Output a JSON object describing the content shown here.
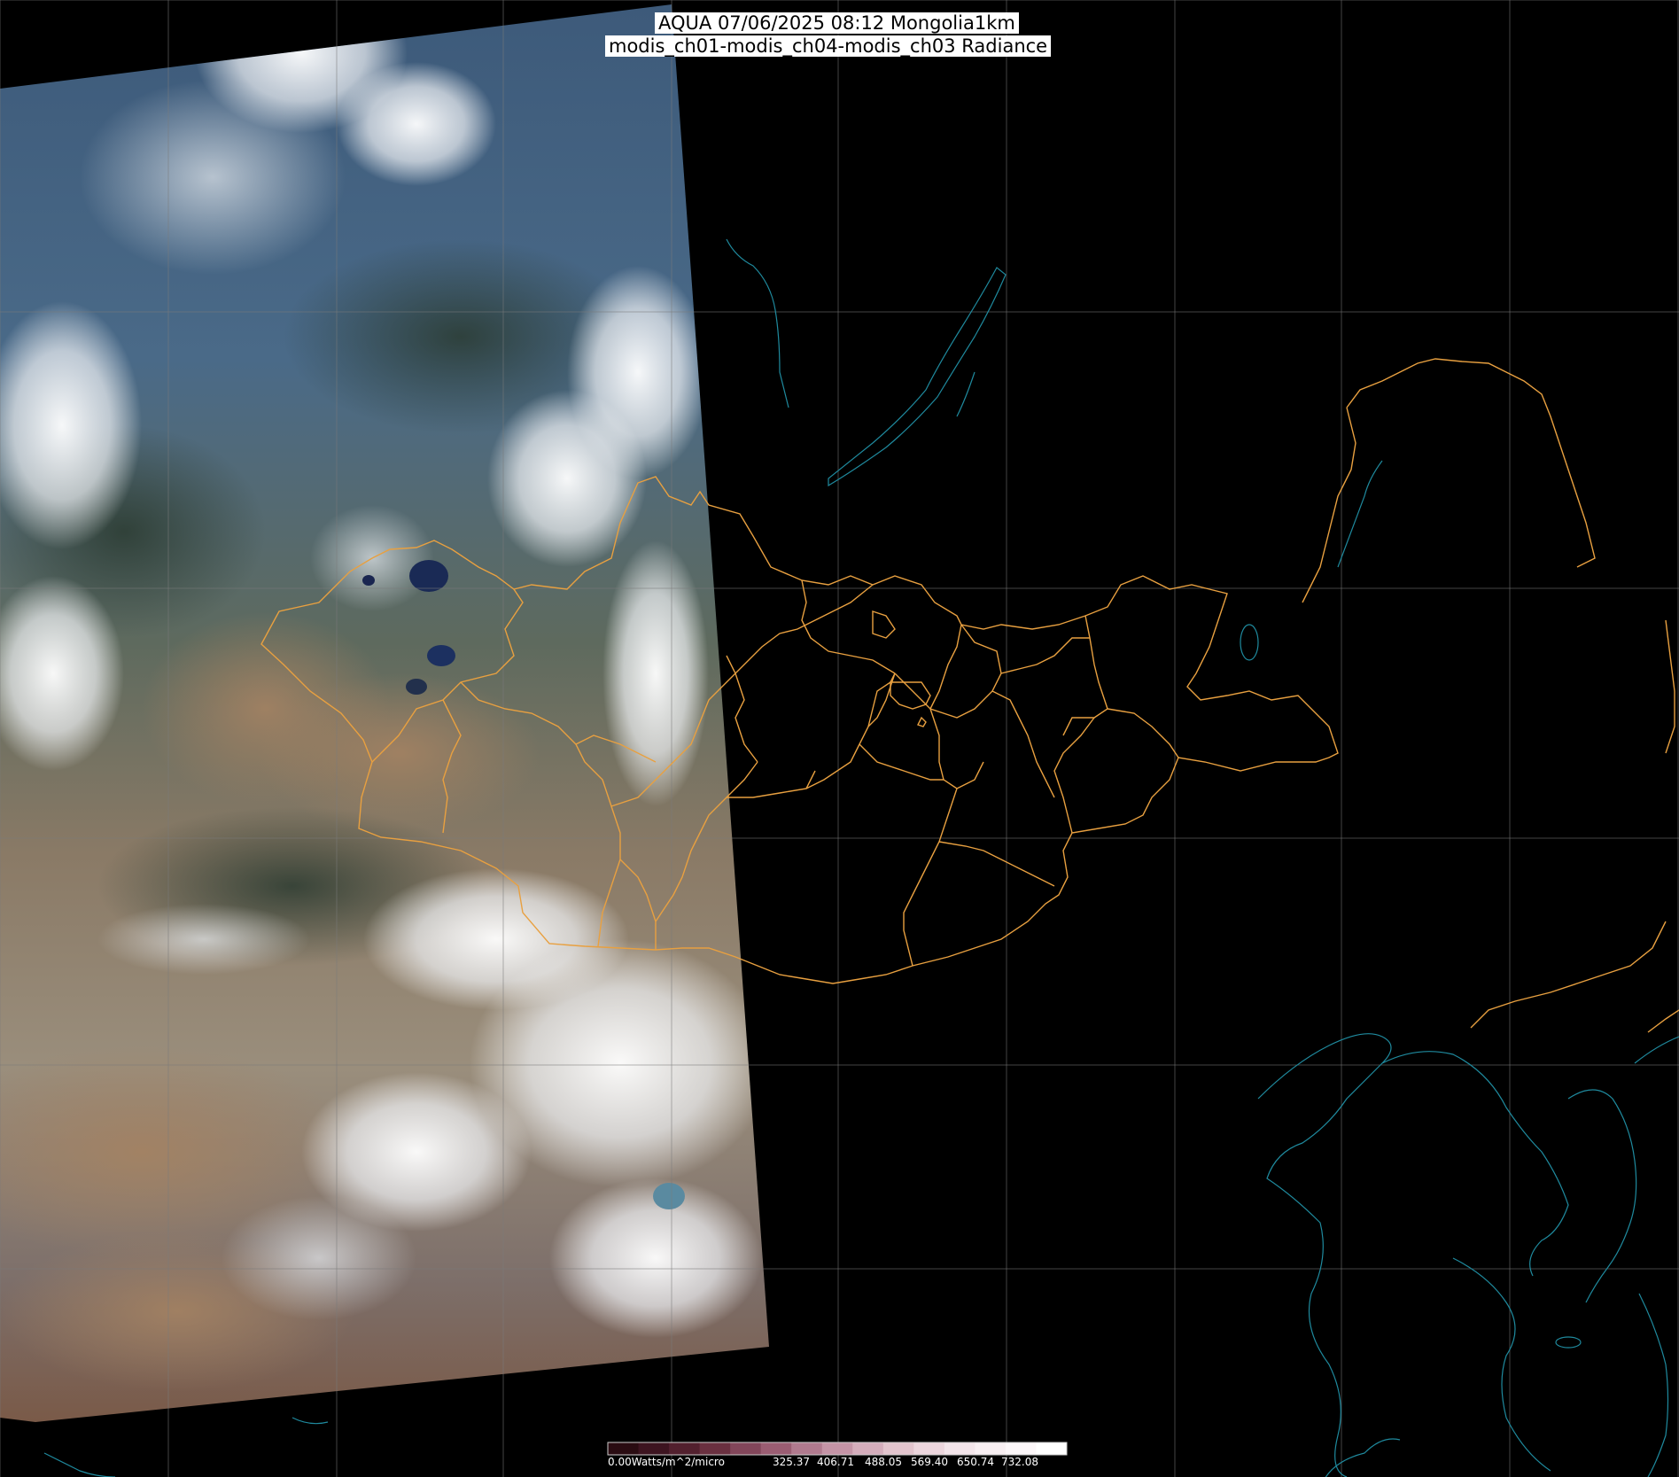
{
  "title": {
    "line1": "AQUA 07/06/2025 08:12 Mongolia1km",
    "line2": "modis_ch01-modis_ch04-modis_ch03 Radiance"
  },
  "colorbar": {
    "labels": [
      "0.00Watts/m^2/micro",
      "325.37",
      "406.71",
      "488.05",
      "569.40",
      "650.74",
      "732.08"
    ],
    "colors": [
      "#2a0c12",
      "#3d1420",
      "#52202e",
      "#6a3040",
      "#82465a",
      "#9a5d72",
      "#b07a8e",
      "#c494a6",
      "#d4adbb",
      "#e2c4cd",
      "#ecd6dd",
      "#f3e5ea",
      "#f8eff2",
      "#fcf7f9",
      "#ffffff"
    ]
  },
  "map": {
    "boundary_color": "#e8a040",
    "coast_color": "#1f8a9e",
    "grid_color": "#7a7a7a"
  }
}
